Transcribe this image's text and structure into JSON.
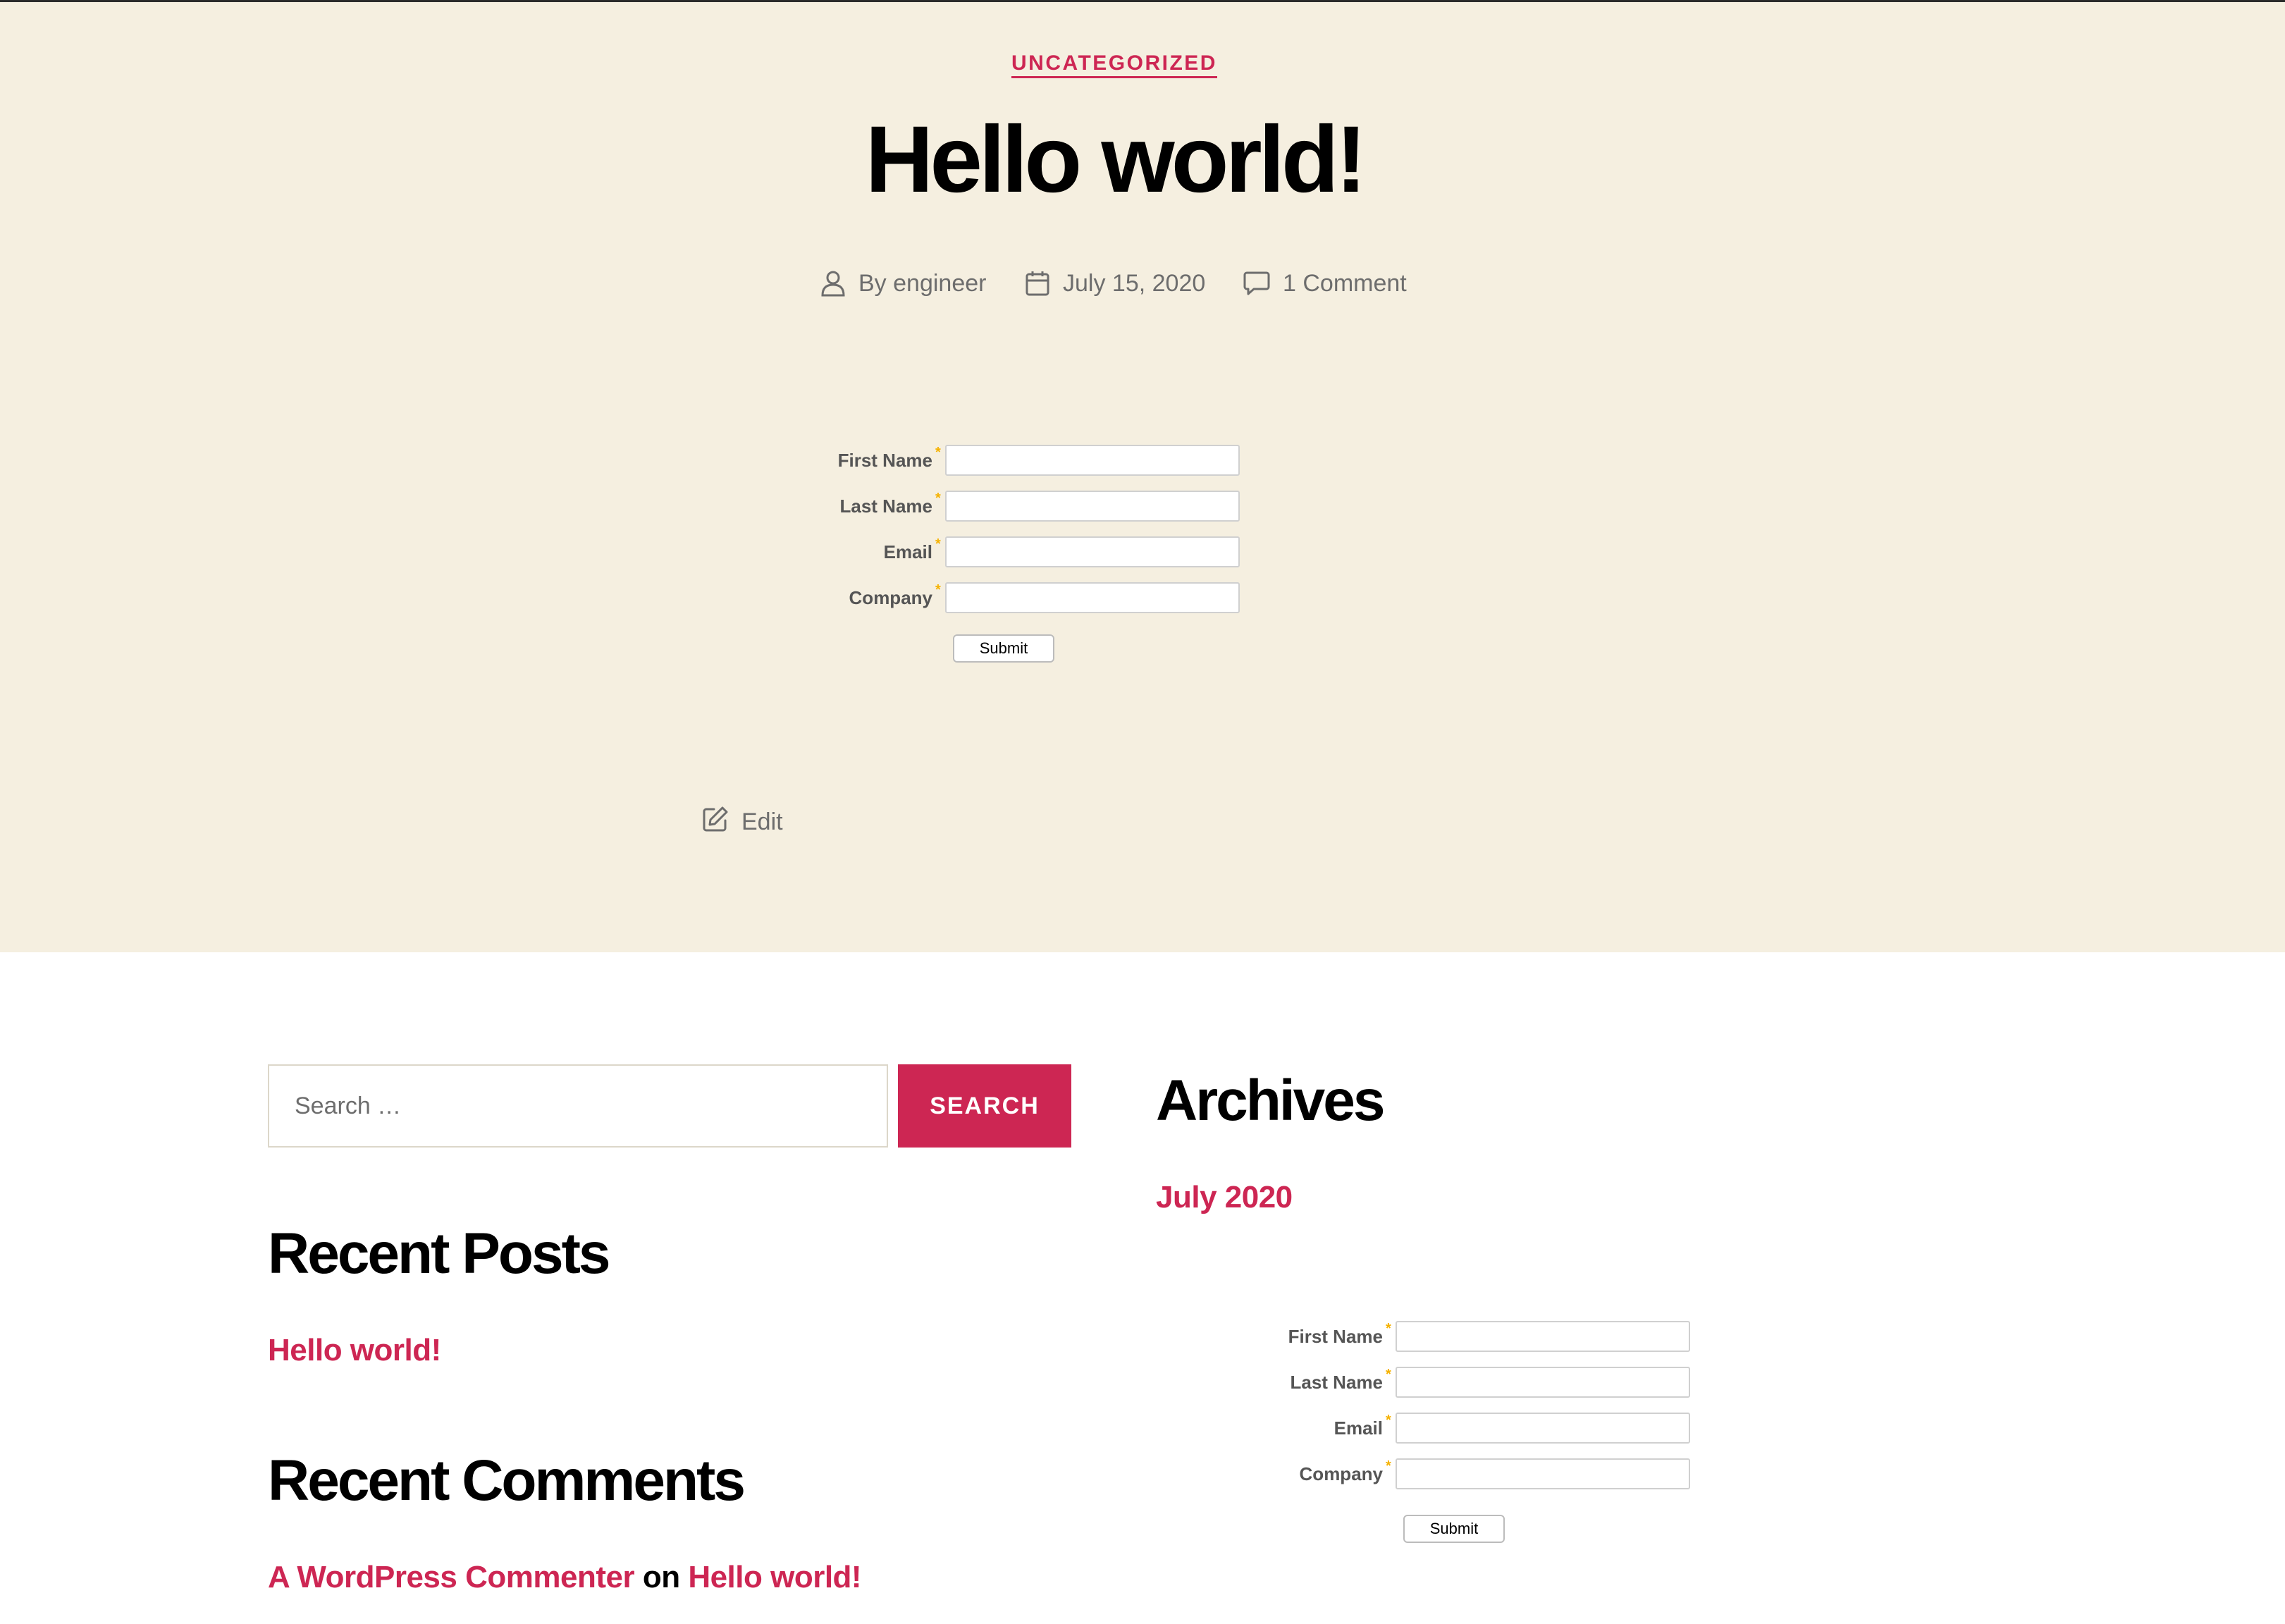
{
  "post": {
    "category": "UNCATEGORIZED",
    "title": "Hello world!",
    "author": "By engineer",
    "date": "July 15, 2020",
    "comments": "1 Comment",
    "edit_label": "Edit"
  },
  "form": {
    "fields": [
      {
        "label": "First Name",
        "value": ""
      },
      {
        "label": "Last Name",
        "value": ""
      },
      {
        "label": "Email",
        "value": ""
      },
      {
        "label": "Company",
        "value": ""
      }
    ],
    "required_marker": "*",
    "submit_label": "Submit"
  },
  "sidebar": {
    "search": {
      "placeholder": "Search …",
      "button_label": "SEARCH"
    },
    "recent_posts": {
      "title": "Recent Posts",
      "items": [
        "Hello world!"
      ]
    },
    "recent_comments": {
      "title": "Recent Comments",
      "items": [
        {
          "author": "A WordPress Commenter",
          "connector": "on",
          "post": "Hello world!"
        }
      ]
    },
    "archives": {
      "title": "Archives",
      "items": [
        "July 2020"
      ]
    }
  },
  "colors": {
    "accent": "#cd2653",
    "hero_background": "#f5efe0",
    "meta_text": "#6d6d6d",
    "required_star": "#f5b200"
  },
  "icons": {
    "author": "user-icon",
    "date": "calendar-icon",
    "comments": "comment-bubble-icon",
    "edit": "edit-pencil-icon"
  }
}
